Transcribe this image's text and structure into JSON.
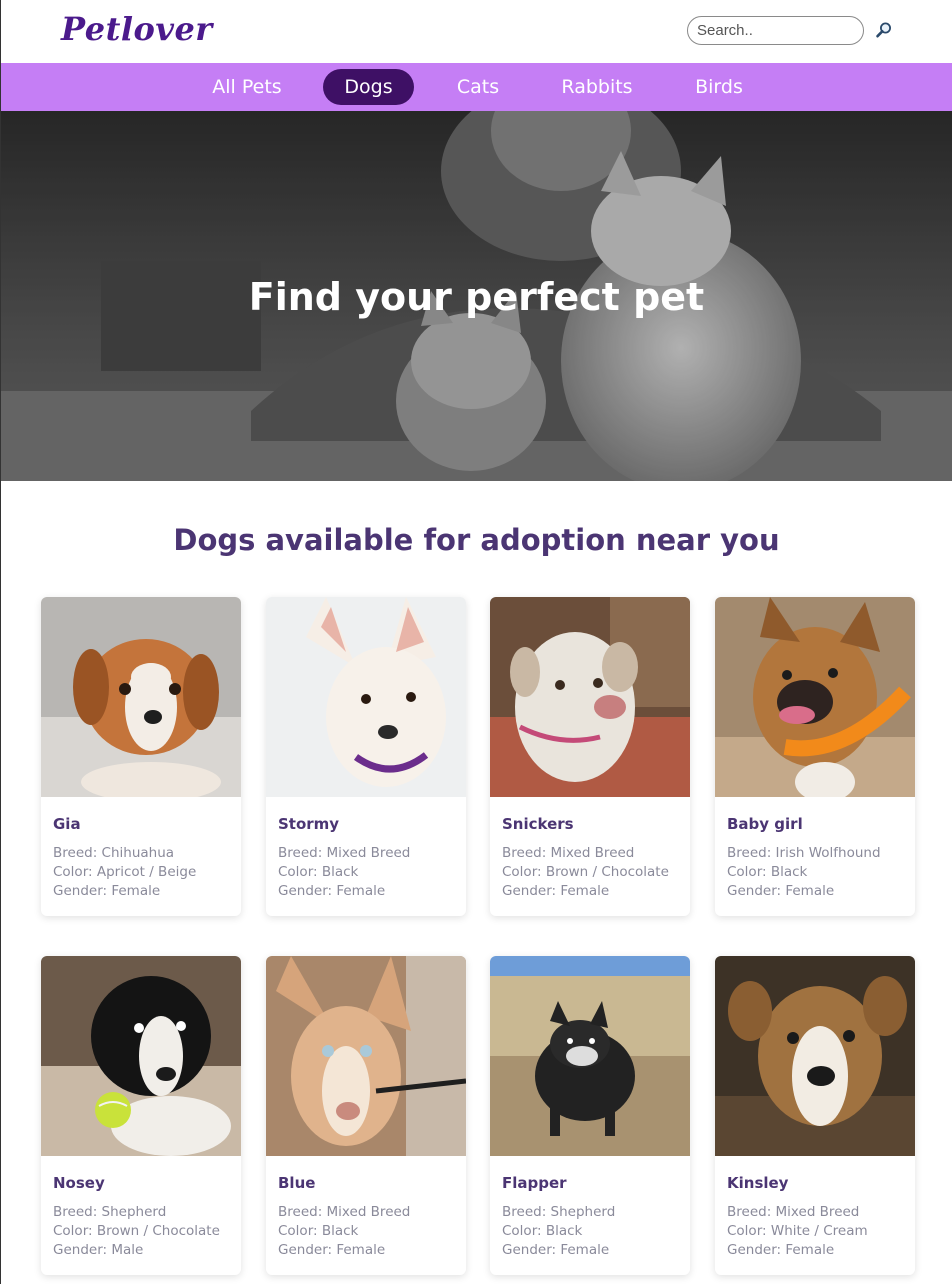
{
  "header": {
    "logo": "Petlover",
    "search_placeholder": "Search..",
    "search_icon": "magnifier-icon"
  },
  "nav": {
    "items": [
      {
        "label": "All Pets",
        "active": false
      },
      {
        "label": "Dogs",
        "active": true
      },
      {
        "label": "Cats",
        "active": false
      },
      {
        "label": "Rabbits",
        "active": false
      },
      {
        "label": "Birds",
        "active": false
      }
    ]
  },
  "hero": {
    "title": "Find your perfect pet"
  },
  "section": {
    "title": "Dogs available for adoption near you"
  },
  "colors": {
    "nav_bg": "#c57ef5",
    "nav_active": "#3e1065",
    "accent_text": "#4b3573",
    "logo": "#4b1a8c",
    "muted_text": "#8a8a9a"
  },
  "dogs": [
    {
      "name": "Gia",
      "breed": "Breed: Chihuahua",
      "color": "Color: Apricot / Beige",
      "gender": "Gender: Female"
    },
    {
      "name": "Stormy",
      "breed": "Breed: Mixed Breed",
      "color": "Color: Black",
      "gender": "Gender: Female"
    },
    {
      "name": "Snickers",
      "breed": "Breed: Mixed Breed",
      "color": "Color: Brown / Chocolate",
      "gender": "Gender: Female"
    },
    {
      "name": "Baby girl",
      "breed": "Breed: Irish Wolfhound",
      "color": "Color: Black",
      "gender": "Gender: Female"
    },
    {
      "name": "Nosey",
      "breed": "Breed: Shepherd",
      "color": "Color: Brown / Chocolate",
      "gender": "Gender: Male"
    },
    {
      "name": "Blue",
      "breed": "Breed: Mixed Breed",
      "color": "Color: Black",
      "gender": "Gender: Female"
    },
    {
      "name": "Flapper",
      "breed": "Breed: Shepherd",
      "color": "Color: Black",
      "gender": "Gender: Female"
    },
    {
      "name": "Kinsley",
      "breed": "Breed: Mixed Breed",
      "color": "Color: White / Cream",
      "gender": "Gender: Female"
    }
  ]
}
